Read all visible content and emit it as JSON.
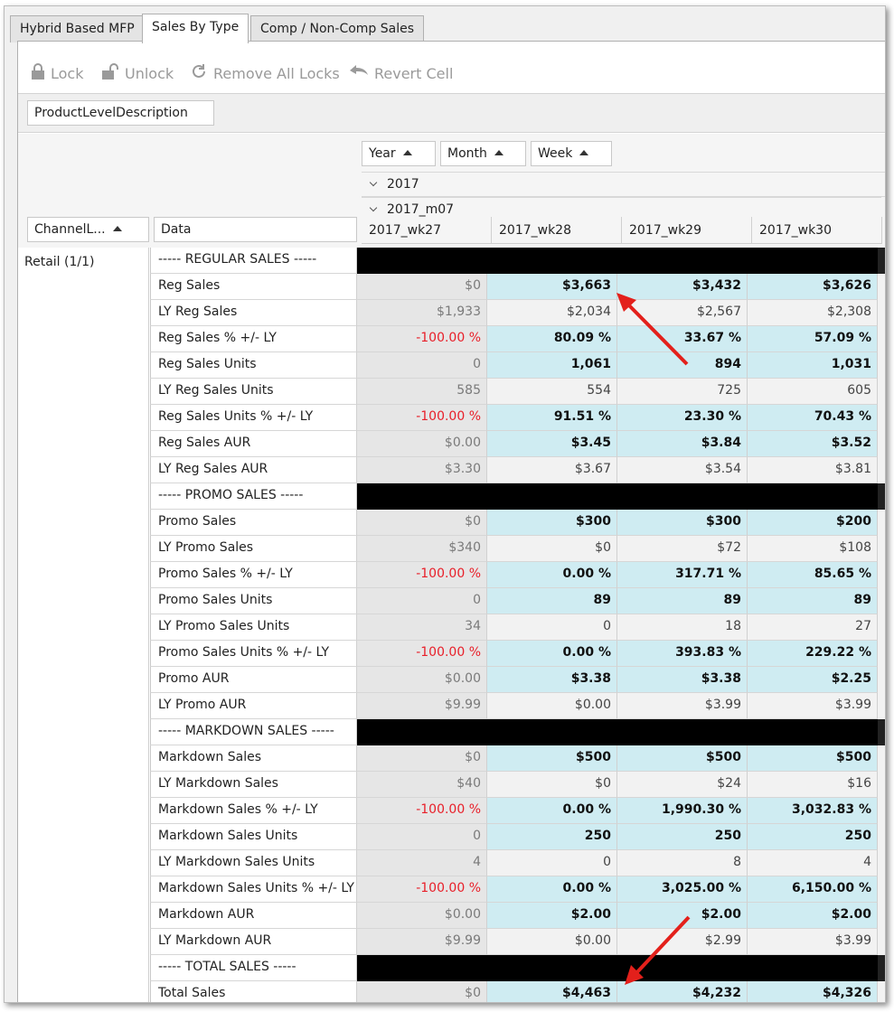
{
  "tabs": [
    {
      "label": "Hybrid Based MFP",
      "active": false
    },
    {
      "label": "Sales By Type",
      "active": true
    },
    {
      "label": "Comp / Non-Comp Sales",
      "active": false
    }
  ],
  "toolbar": {
    "lock": "Lock",
    "unlock": "Unlock",
    "remove_all_locks": "Remove All Locks",
    "revert_cell": "Revert Cell"
  },
  "filter_field": "ProductLevelDescription",
  "column_fields": {
    "year": "Year",
    "month": "Month",
    "week": "Week"
  },
  "row_fields": {
    "channel": "ChannelL...",
    "data": "Data"
  },
  "expanders": {
    "year": "2017",
    "month": "2017_m07"
  },
  "weeks": [
    "2017_wk27",
    "2017_wk28",
    "2017_wk29",
    "2017_wk30"
  ],
  "channel_value": "Retail (1/1)",
  "rows": [
    {
      "label": "----- REGULAR SALES -----",
      "kind": "section"
    },
    {
      "label": "Reg Sales",
      "kind": "blue",
      "wk27": "$0",
      "values": [
        "$3,663",
        "$3,432",
        "$3,626"
      ]
    },
    {
      "label": "LY Reg Sales",
      "kind": "plain",
      "wk27": "$1,933",
      "values": [
        "$2,034",
        "$2,567",
        "$2,308"
      ]
    },
    {
      "label": "Reg Sales % +/- LY",
      "kind": "blue",
      "wk27": "-100.00 %",
      "wk27_negative": true,
      "values": [
        "80.09 %",
        "33.67 %",
        "57.09 %"
      ]
    },
    {
      "label": "Reg Sales Units",
      "kind": "blue",
      "wk27": "0",
      "values": [
        "1,061",
        "894",
        "1,031"
      ]
    },
    {
      "label": "LY Reg Sales Units",
      "kind": "plain",
      "wk27": "585",
      "values": [
        "554",
        "725",
        "605"
      ]
    },
    {
      "label": "Reg Sales Units % +/- LY",
      "kind": "blue",
      "wk27": "-100.00 %",
      "wk27_negative": true,
      "values": [
        "91.51 %",
        "23.30 %",
        "70.43 %"
      ]
    },
    {
      "label": "Reg Sales AUR",
      "kind": "blue",
      "wk27": "$0.00",
      "values": [
        "$3.45",
        "$3.84",
        "$3.52"
      ]
    },
    {
      "label": "LY Reg Sales AUR",
      "kind": "plain",
      "wk27": "$3.30",
      "values": [
        "$3.67",
        "$3.54",
        "$3.81"
      ]
    },
    {
      "label": "----- PROMO SALES -----",
      "kind": "section"
    },
    {
      "label": "Promo Sales",
      "kind": "blue",
      "wk27": "$0",
      "values": [
        "$300",
        "$300",
        "$200"
      ]
    },
    {
      "label": "LY Promo Sales",
      "kind": "plain",
      "wk27": "$340",
      "values": [
        "$0",
        "$72",
        "$108"
      ]
    },
    {
      "label": "Promo Sales % +/- LY",
      "kind": "blue",
      "wk27": "-100.00 %",
      "wk27_negative": true,
      "values": [
        "0.00 %",
        "317.71 %",
        "85.65 %"
      ]
    },
    {
      "label": "Promo Sales Units",
      "kind": "blue",
      "wk27": "0",
      "values": [
        "89",
        "89",
        "89"
      ]
    },
    {
      "label": "LY Promo Sales Units",
      "kind": "plain",
      "wk27": "34",
      "values": [
        "0",
        "18",
        "27"
      ]
    },
    {
      "label": "Promo Sales Units % +/- LY",
      "kind": "blue",
      "wk27": "-100.00 %",
      "wk27_negative": true,
      "values": [
        "0.00 %",
        "393.83 %",
        "229.22 %"
      ]
    },
    {
      "label": "Promo AUR",
      "kind": "blue",
      "wk27": "$0.00",
      "values": [
        "$3.38",
        "$3.38",
        "$2.25"
      ]
    },
    {
      "label": "LY Promo AUR",
      "kind": "plain",
      "wk27": "$9.99",
      "values": [
        "$0.00",
        "$3.99",
        "$3.99"
      ]
    },
    {
      "label": "----- MARKDOWN SALES -----",
      "kind": "section"
    },
    {
      "label": "Markdown Sales",
      "kind": "blue",
      "wk27": "$0",
      "values": [
        "$500",
        "$500",
        "$500"
      ]
    },
    {
      "label": "LY Markdown Sales",
      "kind": "plain",
      "wk27": "$40",
      "values": [
        "$0",
        "$24",
        "$16"
      ]
    },
    {
      "label": "Markdown Sales % +/- LY",
      "kind": "blue",
      "wk27": "-100.00 %",
      "wk27_negative": true,
      "values": [
        "0.00 %",
        "1,990.30 %",
        "3,032.83 %"
      ]
    },
    {
      "label": "Markdown Sales Units",
      "kind": "blue",
      "wk27": "0",
      "values": [
        "250",
        "250",
        "250"
      ]
    },
    {
      "label": "LY Markdown Sales Units",
      "kind": "plain",
      "wk27": "4",
      "values": [
        "0",
        "8",
        "4"
      ]
    },
    {
      "label": "Markdown Sales Units % +/- LY",
      "kind": "blue",
      "wk27": "-100.00 %",
      "wk27_negative": true,
      "values": [
        "0.00 %",
        "3,025.00 %",
        "6,150.00 %"
      ]
    },
    {
      "label": "Markdown AUR",
      "kind": "blue",
      "wk27": "$0.00",
      "values": [
        "$2.00",
        "$2.00",
        "$2.00"
      ]
    },
    {
      "label": "LY Markdown AUR",
      "kind": "plain",
      "wk27": "$9.99",
      "values": [
        "$0.00",
        "$2.99",
        "$3.99"
      ]
    },
    {
      "label": "----- TOTAL SALES -----",
      "kind": "section"
    },
    {
      "label": "Total Sales",
      "kind": "blue",
      "wk27": "$0",
      "values": [
        "$4,463",
        "$4,232",
        "$4,326"
      ]
    }
  ],
  "colors": {
    "editable_cell": "#cfecf2",
    "negative_text": "#e8202a",
    "section_row": "#000000",
    "annotation_arrow": "#e3201b"
  }
}
